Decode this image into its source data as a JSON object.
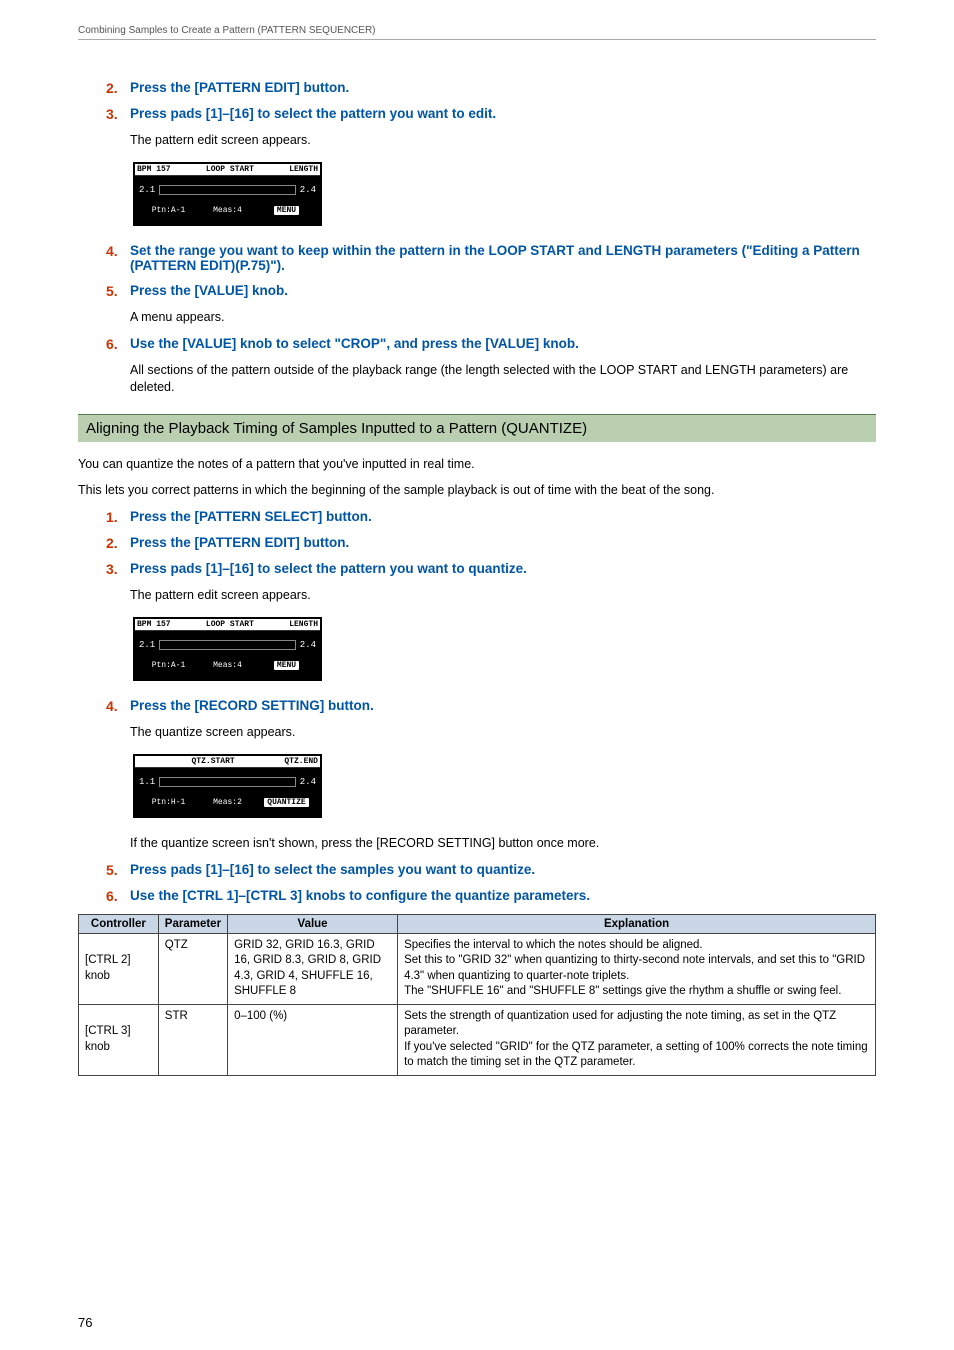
{
  "header": "Combining Samples to Create a Pattern (PATTERN SEQUENCER)",
  "steps_a": [
    {
      "n": "2.",
      "t": "Press the [PATTERN EDIT] button."
    },
    {
      "n": "3.",
      "t": "Press pads [1]–[16] to select the pattern you want to edit."
    }
  ],
  "lcd1": {
    "topLeft": "BPM 157",
    "topMid": "LOOP START",
    "topRight": "LENGTH",
    "left": "2.1",
    "right": "2.4",
    "label1": "Ptn:A-1",
    "label2": "Meas:4",
    "menu": "MENU",
    "caption": "The pattern edit screen appears."
  },
  "step4a_pre": "Set the range you want to keep within the pattern in the LOOP START and LENGTH parameters (",
  "step4a_link": "\"Editing a Pattern (PATTERN EDIT)(P.75)\"",
  "step4a_post": ").",
  "step5a": "Press the [VALUE] knob.",
  "step5a_body": "A menu appears.",
  "step6a": "Use the [VALUE] knob to select \"CROP\", and press the [VALUE] knob.",
  "step6a_body": "All sections of the pattern outside of the playback range (the length selected with the LOOP START and LENGTH parameters) are deleted.",
  "section": "Aligning the Playback Timing of Samples Inputted to a Pattern (QUANTIZE)",
  "intro1": "You can quantize the notes of a pattern that you've inputted in real time.",
  "intro2": "This lets you correct patterns in which the beginning of the sample playback is out of time with the beat of the song.",
  "steps_b": [
    {
      "n": "1.",
      "t": "Press the [PATTERN SELECT] button."
    },
    {
      "n": "2.",
      "t": "Press the [PATTERN EDIT] button."
    },
    {
      "n": "3.",
      "t": "Press pads [1]–[16] to select the pattern you want to quantize."
    }
  ],
  "lcd2_caption": "The pattern edit screen appears.",
  "step4b": "Press the [RECORD SETTING] button.",
  "lcd3": {
    "caption": "The quantize screen appears.",
    "topMid": "QTZ.START",
    "topRight": "QTZ.END",
    "left": "1.1",
    "right": "2.4",
    "label1": "Ptn:H-1",
    "label2": "Meas:2",
    "menu": "QUANTIZE",
    "note": "If the quantize screen isn't shown, press the [RECORD SETTING] button once more."
  },
  "step5b": "Press pads [1]–[16] to select the samples you want to quantize.",
  "step6b": "Use the [CTRL 1]–[CTRL 3] knobs to configure the quantize parameters.",
  "table": {
    "headers": [
      "Controller",
      "Parameter",
      "Value",
      "Explanation"
    ],
    "rows": [
      {
        "controller": "[CTRL 2] knob",
        "param": "QTZ",
        "value": "GRID 32, GRID 16.3, GRID 16, GRID 8.3, GRID 8, GRID 4.3, GRID 4, SHUFFLE 16, SHUFFLE 8",
        "expl": "Specifies the interval to which the notes should be aligned.\nSet this to \"GRID 32\" when quantizing to thirty-second note intervals, and set this to \"GRID 4.3\" when quantizing to quarter-note triplets.\nThe \"SHUFFLE 16\" and \"SHUFFLE 8\" settings give the rhythm a shuffle or swing feel."
      },
      {
        "controller": "[CTRL 3] knob",
        "param": "STR",
        "value": "0–100 (%)",
        "expl": "Sets the strength of quantization used for adjusting the note timing, as set in the QTZ parameter.\nIf you've selected \"GRID\" for the QTZ parameter, a setting of 100% corrects the note timing to match the timing set in the QTZ parameter."
      }
    ]
  },
  "pagenum": "76"
}
